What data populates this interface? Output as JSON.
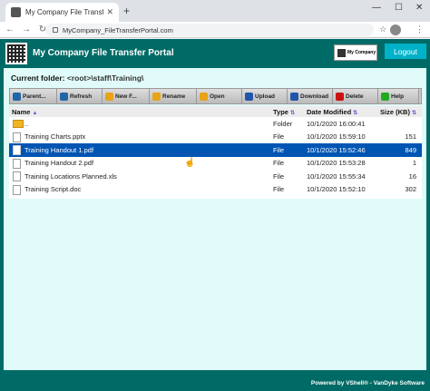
{
  "browser": {
    "tab_title": "My Company File Transfer Portal",
    "url": "MyCompany_FileTransferPortal.com"
  },
  "app": {
    "title": "My Company File Transfer Portal",
    "company_logo_text": "My Company",
    "logout_label": "Logout",
    "current_folder_label": "Current folder:",
    "current_folder_path": "<root>\\staff\\Training\\",
    "footer": "Powered by VShell® - VanDyke Software"
  },
  "actions": [
    {
      "label": "Parent...",
      "icon": "parent-folder-icon",
      "color": "#2266aa"
    },
    {
      "label": "Refresh",
      "icon": "refresh-icon",
      "color": "#2266aa"
    },
    {
      "label": "New F...",
      "icon": "new-folder-icon",
      "color": "#e8a317"
    },
    {
      "label": "Rename",
      "icon": "rename-icon",
      "color": "#e8a317"
    },
    {
      "label": "Open",
      "icon": "open-folder-icon",
      "color": "#e8a317"
    },
    {
      "label": "Upload",
      "icon": "upload-icon",
      "color": "#2255aa"
    },
    {
      "label": "Download",
      "icon": "download-icon",
      "color": "#2255aa"
    },
    {
      "label": "Delete",
      "icon": "delete-icon",
      "color": "#cc1111"
    },
    {
      "label": "Help",
      "icon": "help-icon",
      "color": "#22aa22"
    }
  ],
  "columns": {
    "name": "Name",
    "type": "Type",
    "date": "Date Modified",
    "size": "Size (KB)"
  },
  "rows": [
    {
      "name": "..",
      "type": "Folder",
      "date": "10/1/2020 16:00:41",
      "size": "",
      "kind": "folder",
      "selected": false
    },
    {
      "name": "Training Charts.pptx",
      "type": "File",
      "date": "10/1/2020 15:59:10",
      "size": "151",
      "kind": "file",
      "selected": false
    },
    {
      "name": "Training Handout 1.pdf",
      "type": "File",
      "date": "10/1/2020 15:52:46",
      "size": "849",
      "kind": "file",
      "selected": true
    },
    {
      "name": "Training Handout 2.pdf",
      "type": "File",
      "date": "10/1/2020 15:53:28",
      "size": "1",
      "kind": "file",
      "selected": false
    },
    {
      "name": "Training Locations Planned.xls",
      "type": "File",
      "date": "10/1/2020 15:55:34",
      "size": "16",
      "kind": "file",
      "selected": false
    },
    {
      "name": "Training Script.doc",
      "type": "File",
      "date": "10/1/2020 15:52:10",
      "size": "302",
      "kind": "file",
      "selected": false
    }
  ]
}
